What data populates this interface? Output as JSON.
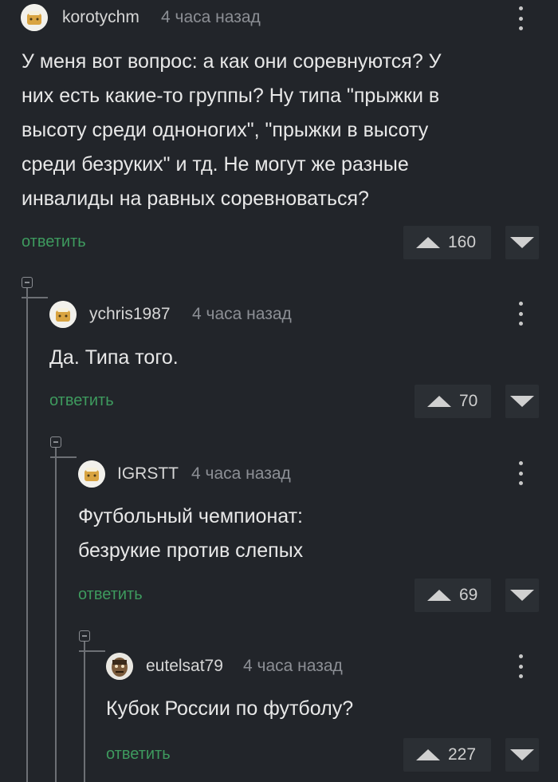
{
  "colors": {
    "background": "#22252a",
    "reply_green": "#3e9a5e",
    "vote_box": "#2b2f34"
  },
  "icons": {
    "menu": "vertical-dots-icon",
    "upvote": "triangle-up-icon",
    "downvote": "triangle-down-icon",
    "collapse": "minus-box-icon"
  },
  "comments": [
    {
      "user": "korotychm",
      "time": "4 часа назад",
      "text_lines": [
        "У меня вот вопрос: а как они соревнуются? У",
        "них есть какие-то группы? Ну типа \"прыжки в",
        "высоту среди одноногих\", \"прыжки в высоту",
        "среди безруких\" и тд. Не могут же разные",
        "инвалиды на равных соревноваться?"
      ],
      "reply_label": "ответить",
      "rating": "160"
    },
    {
      "user": "ychris1987",
      "time": "4 часа назад",
      "text_lines": [
        "Да. Типа того."
      ],
      "reply_label": "ответить",
      "rating": "70"
    },
    {
      "user": "IGRSTT",
      "time": "4 часа назад",
      "text_lines": [
        "Футбольный чемпионат:",
        "безрукие против слепых"
      ],
      "reply_label": "ответить",
      "rating": "69"
    },
    {
      "user": "eutelsat79",
      "time": "4 часа назад",
      "text_lines": [
        "Кубок России по футболу?"
      ],
      "reply_label": "ответить",
      "rating": "227"
    }
  ]
}
